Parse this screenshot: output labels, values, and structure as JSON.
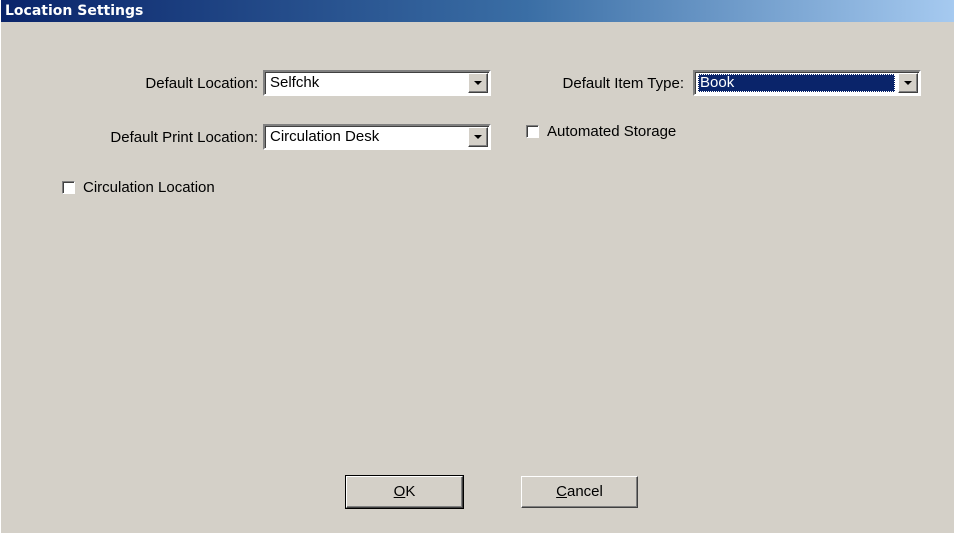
{
  "window": {
    "title": "Location Settings"
  },
  "fields": {
    "default_location": {
      "label": "Default Location:",
      "value": "Selfchk"
    },
    "default_print_location": {
      "label": "Default Print Location:",
      "value": "Circulation Desk"
    },
    "default_item_type": {
      "label": "Default Item Type:",
      "value": "Book"
    }
  },
  "checkboxes": {
    "automated_storage": {
      "label": "Automated Storage",
      "checked": false
    },
    "circulation_location": {
      "label": "Circulation Location",
      "checked": false
    }
  },
  "buttons": {
    "ok": {
      "mnemonic": "O",
      "rest": "K"
    },
    "cancel": {
      "mnemonic": "C",
      "rest": "ancel"
    }
  },
  "icons": {
    "dropdown": "chevron-down-icon"
  },
  "colors": {
    "title_bar_start": "#0a246a",
    "title_bar_end": "#a6caf0",
    "dialog_background": "#d4d0c8",
    "selection_highlight": "#0a246a"
  }
}
